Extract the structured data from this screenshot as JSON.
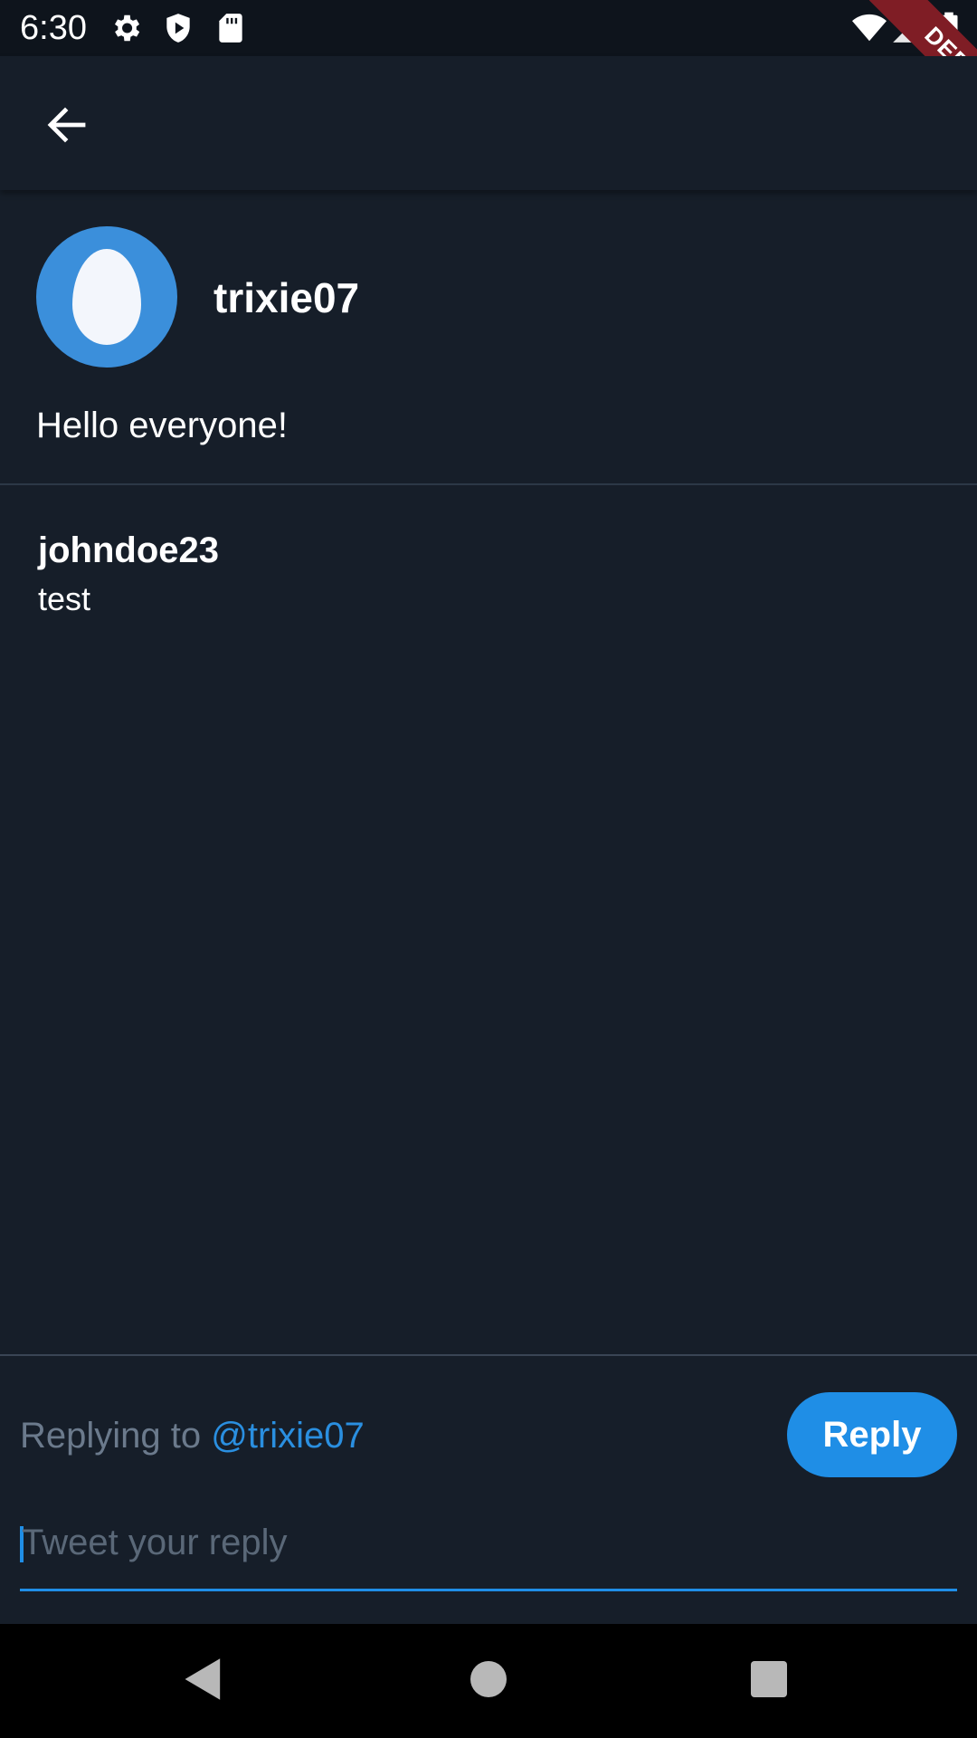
{
  "status_bar": {
    "time": "6:30",
    "icons": [
      "gear-icon",
      "shield-play-icon",
      "sd-card-icon",
      "wifi-icon",
      "signal-icon",
      "battery-icon"
    ],
    "debug_label": "DEBUG"
  },
  "app_bar": {
    "back_icon": "arrow-left-icon"
  },
  "post": {
    "author": "trixie07",
    "text": "Hello everyone!",
    "avatar_color": "#3b8fdb"
  },
  "comments": [
    {
      "author": "johndoe23",
      "text": "test"
    }
  ],
  "composer": {
    "replying_prefix": "Replying to ",
    "mention": "@trixie07",
    "reply_label": "Reply",
    "placeholder": "Tweet your reply",
    "accent": "#1f8ee6"
  },
  "nav_bar": {
    "icons": [
      "back-triangle-icon",
      "home-circle-icon",
      "recents-square-icon"
    ]
  }
}
